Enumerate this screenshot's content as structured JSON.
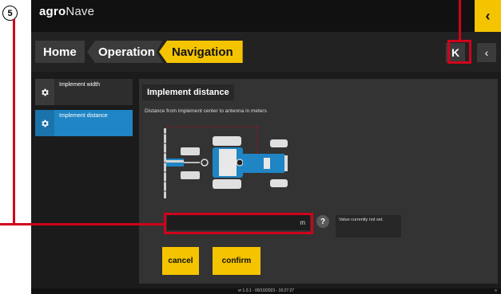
{
  "callout": {
    "number": "5"
  },
  "app": {
    "brand_primary": "agro",
    "brand_secondary": "Nave"
  },
  "topbar": {
    "corner_icon": "chevron-left-icon",
    "corner_glyph": "‹"
  },
  "breadcrumb": {
    "home": "Home",
    "operation": "Operation",
    "navigation": "Navigation"
  },
  "nav_buttons": {
    "collapse_glyph": "K",
    "back_glyph": "‹"
  },
  "sidebar": {
    "items": [
      {
        "label": "Implement width",
        "icon": "gear-icon",
        "active": false
      },
      {
        "label": "Implement distance",
        "icon": "gear-icon",
        "active": true
      }
    ]
  },
  "panel": {
    "title": "Implement distance",
    "description": "Distance from implement center to antenna in meters",
    "input": {
      "value": "",
      "unit": "m"
    },
    "help": "?",
    "status": "Value currently not set.",
    "cancel_label": "cancel",
    "confirm_label": "confirm"
  },
  "footer": {
    "version": "vr 1.0.1 - 09/10/2023 - 16:27:27",
    "mark": "≡"
  },
  "colors": {
    "accent": "#f5c400",
    "active": "#1f85c4",
    "callout": "#d0021b",
    "tractor": "#1f85c4"
  }
}
